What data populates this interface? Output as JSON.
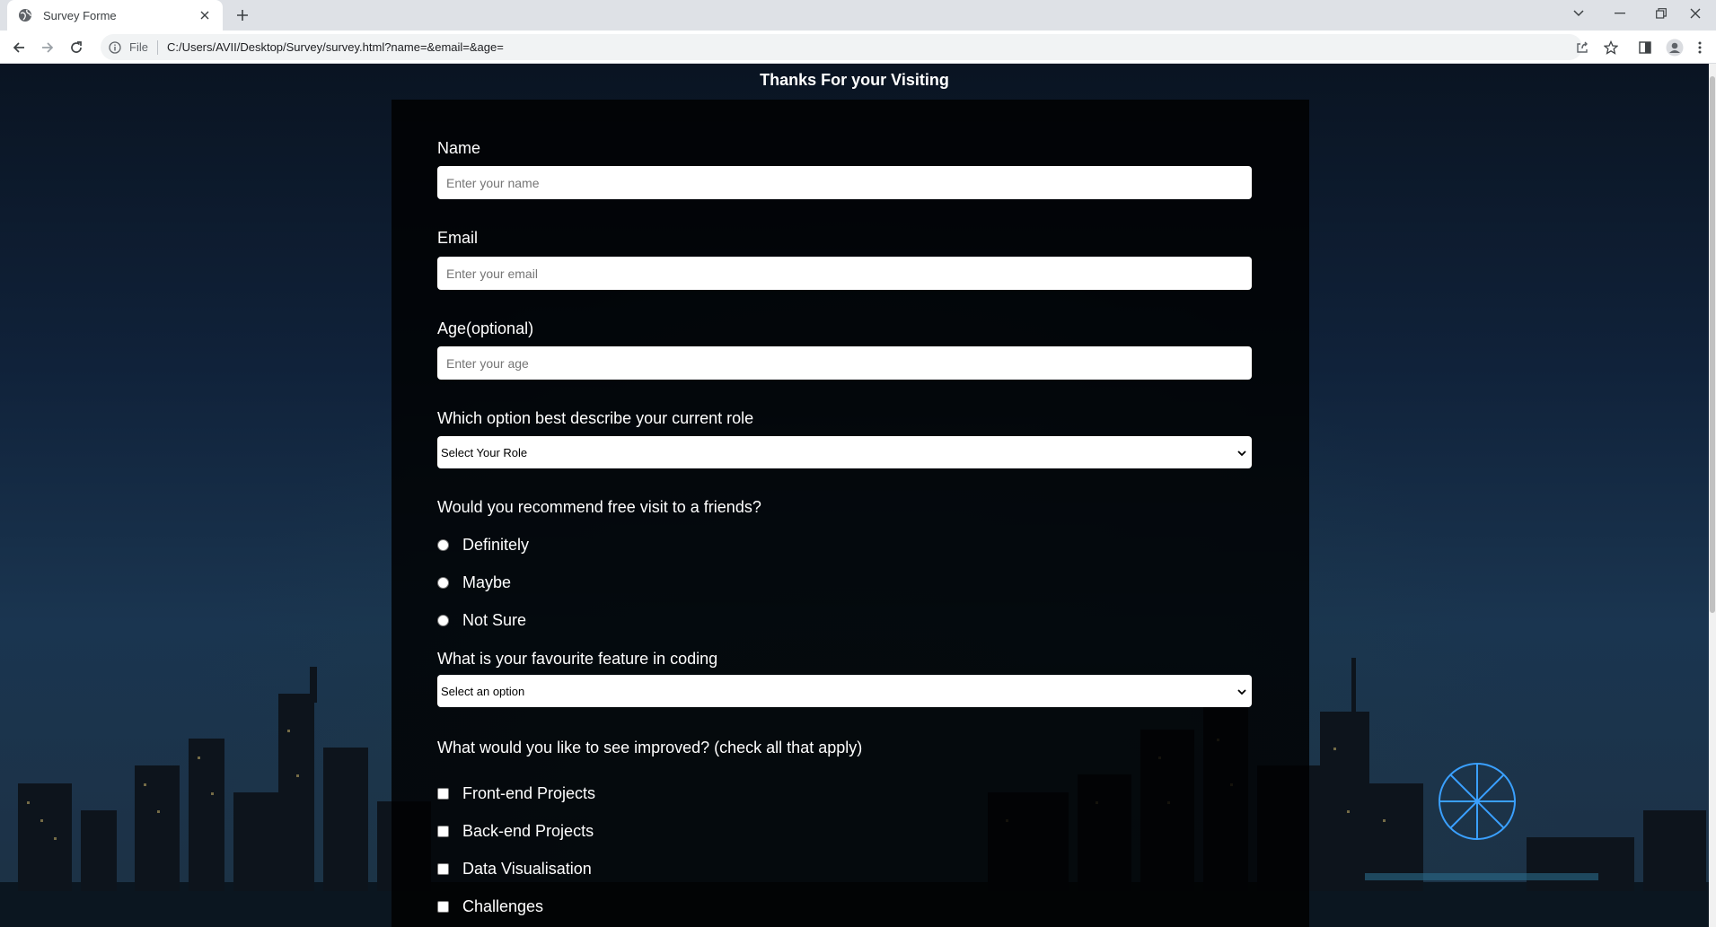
{
  "browser": {
    "tab_title": "Survey Forme",
    "omnibox_scheme": "File",
    "url": "C:/Users/AVII/Desktop/Survey/survey.html?name=&email=&age="
  },
  "page": {
    "heading": "Thanks For your Visiting"
  },
  "form": {
    "name": {
      "label": "Name",
      "placeholder": "Enter your name",
      "value": ""
    },
    "email": {
      "label": "Email",
      "placeholder": "Enter your email",
      "value": ""
    },
    "age": {
      "label": "Age(optional)",
      "placeholder": "Enter your age",
      "value": ""
    },
    "role": {
      "label": "Which option best describe your current role",
      "selected": "Select Your Role"
    },
    "recommend": {
      "label": "Would you recommend free visit to a friends?",
      "options": [
        "Definitely",
        "Maybe",
        "Not Sure"
      ]
    },
    "feature": {
      "label": "What is your favourite feature in coding",
      "selected": "Select an option"
    },
    "improve": {
      "label": "What would you like to see improved? (check all that apply)",
      "options": [
        "Front-end Projects",
        "Back-end Projects",
        "Data Visualisation",
        "Challenges"
      ]
    }
  }
}
